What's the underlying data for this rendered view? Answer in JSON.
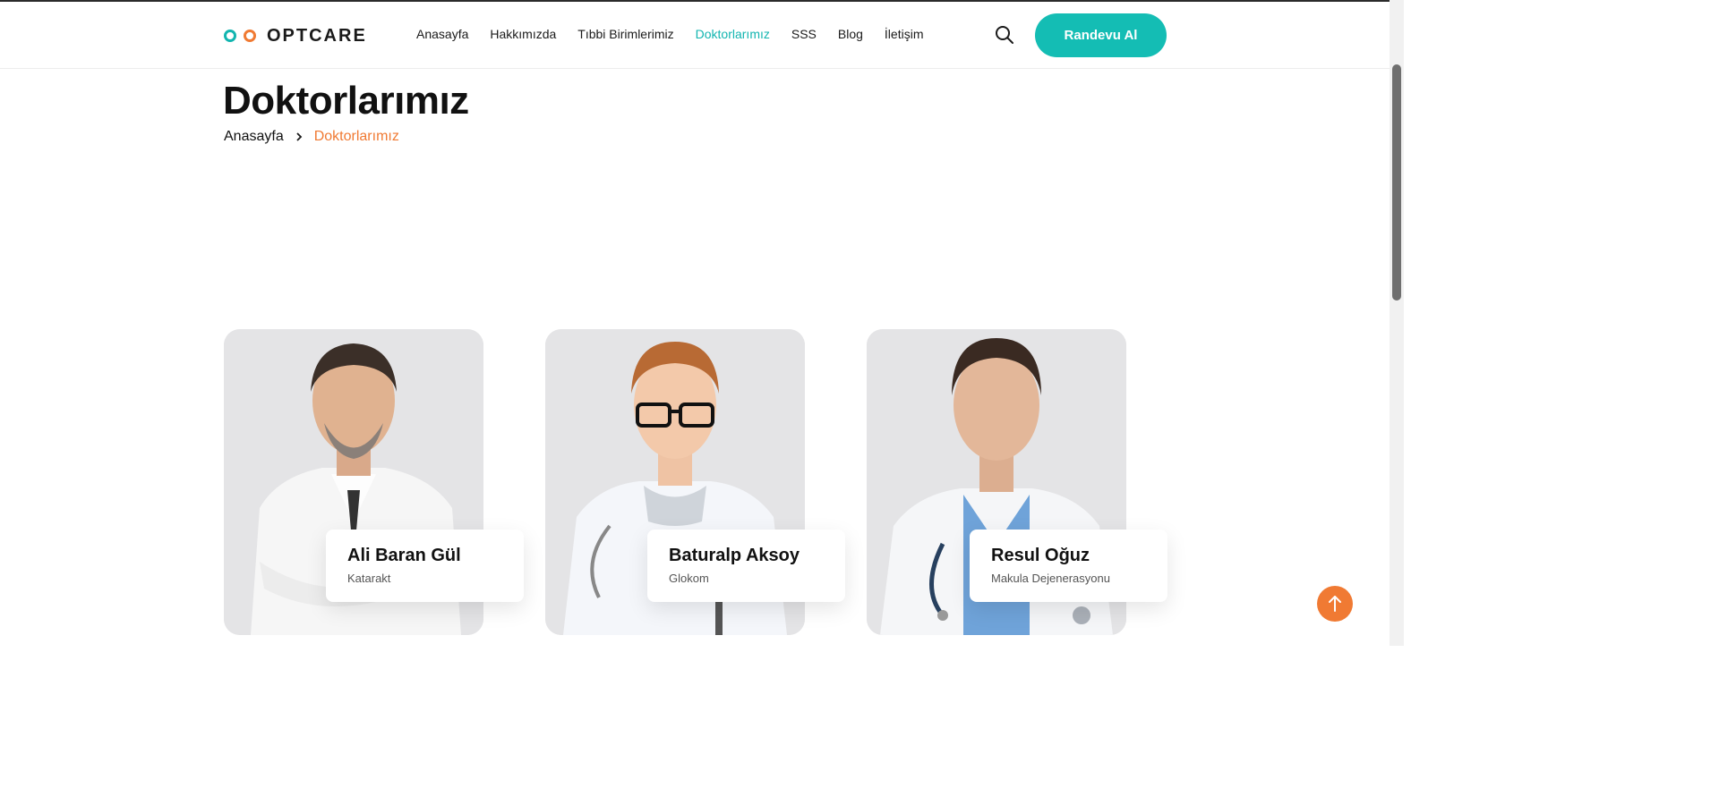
{
  "header": {
    "logo_text": "OPTCARE",
    "nav": [
      "Anasayfa",
      "Hakkımızda",
      "Tıbbi Birimlerimiz",
      "Doktorlarımız",
      "SSS",
      "Blog",
      "İletişim"
    ],
    "active_nav": "Doktorlarımız",
    "cta_label": "Randevu Al"
  },
  "page": {
    "title": "Doktorlarımız",
    "breadcrumb": {
      "home": "Anasayfa",
      "current": "Doktorlarımız"
    }
  },
  "doctors": [
    {
      "name": "Ali Baran Gül",
      "specialty": "Katarakt"
    },
    {
      "name": "Baturalp Aksoy",
      "specialty": "Glokom"
    },
    {
      "name": "Resul Oğuz",
      "specialty": "Makula Dejenerasyonu"
    }
  ],
  "colors": {
    "accent_teal": "#14bdb4",
    "accent_orange": "#f07a33",
    "text_dark": "#111111"
  },
  "icons": {
    "search": "search-icon",
    "breadcrumb_sep": "chevron-right-icon",
    "scroll_top": "arrow-up-icon"
  }
}
